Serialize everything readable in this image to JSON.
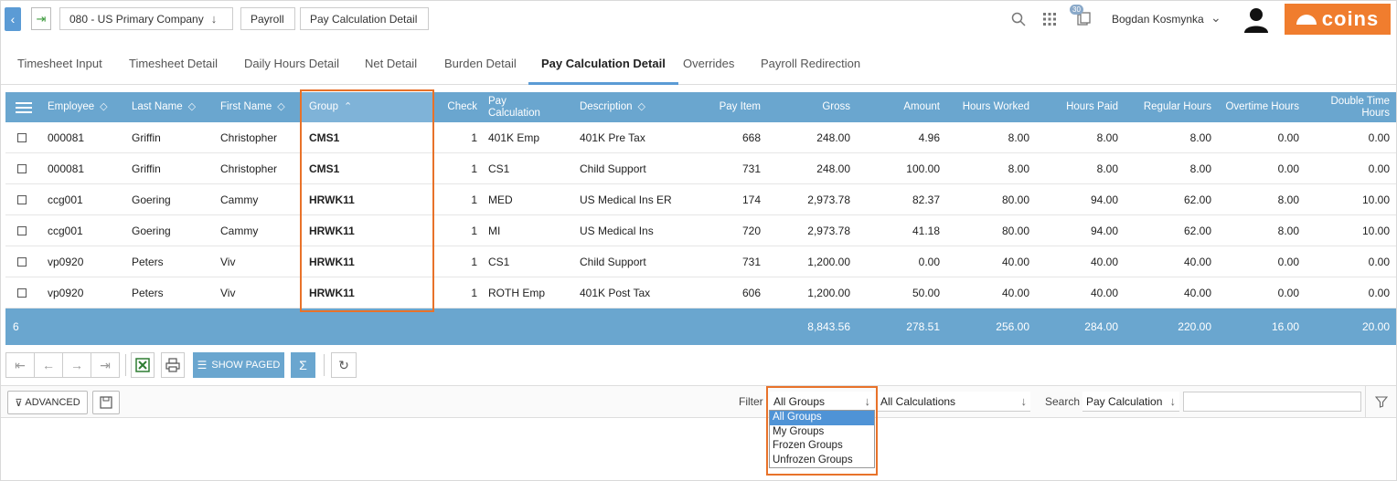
{
  "breadcrumb": {
    "company": "080 - US Primary Company",
    "module": "Payroll",
    "page": "Pay Calculation Detail"
  },
  "header": {
    "notification_count": "30",
    "username": "Bogdan Kosmynka",
    "logo_text": "coins",
    "accent_color": "#f07d2e"
  },
  "tabs": [
    {
      "label": "Timesheet Input"
    },
    {
      "label": "Timesheet Detail"
    },
    {
      "label": "Daily Hours Detail"
    },
    {
      "label": "Net Detail"
    },
    {
      "label": "Burden Detail"
    },
    {
      "label": "Pay Calculation Detail",
      "active": true
    },
    {
      "label": "Overrides"
    },
    {
      "label": "Payroll Redirection"
    }
  ],
  "grid": {
    "header_color": "#6aa6cf",
    "columns": {
      "employee": "Employee",
      "last_name": "Last Name",
      "first_name": "First Name",
      "group": "Group",
      "check": "Check",
      "pay_calc_1": "Pay",
      "pay_calc_2": "Calculation",
      "description": "Description",
      "pay_item": "Pay Item",
      "gross": "Gross",
      "amount": "Amount",
      "hours_worked": "Hours Worked",
      "hours_paid": "Hours Paid",
      "regular_hours": "Regular Hours",
      "overtime_hours": "Overtime Hours",
      "double_time_1": "Double Time",
      "double_time_2": "Hours"
    },
    "rows": [
      {
        "employee": "000081",
        "last_name": "Griffin",
        "first_name": "Christopher",
        "group": "CMS1",
        "check": "1",
        "pay_calc": "401K Emp",
        "description": "401K Pre Tax",
        "pay_item": "668",
        "gross": "248.00",
        "amount": "4.96",
        "hours_worked": "8.00",
        "hours_paid": "8.00",
        "regular_hours": "8.00",
        "overtime_hours": "0.00",
        "double_time": "0.00"
      },
      {
        "employee": "000081",
        "last_name": "Griffin",
        "first_name": "Christopher",
        "group": "CMS1",
        "check": "1",
        "pay_calc": "CS1",
        "description": "Child Support",
        "pay_item": "731",
        "gross": "248.00",
        "amount": "100.00",
        "hours_worked": "8.00",
        "hours_paid": "8.00",
        "regular_hours": "8.00",
        "overtime_hours": "0.00",
        "double_time": "0.00"
      },
      {
        "employee": "ccg001",
        "last_name": "Goering",
        "first_name": "Cammy",
        "group": "HRWK11",
        "check": "1",
        "pay_calc": "MED",
        "description": "US Medical Ins ER",
        "pay_item": "174",
        "gross": "2,973.78",
        "amount": "82.37",
        "hours_worked": "80.00",
        "hours_paid": "94.00",
        "regular_hours": "62.00",
        "overtime_hours": "8.00",
        "double_time": "10.00"
      },
      {
        "employee": "ccg001",
        "last_name": "Goering",
        "first_name": "Cammy",
        "group": "HRWK11",
        "check": "1",
        "pay_calc": "MI",
        "description": "US Medical Ins",
        "pay_item": "720",
        "gross": "2,973.78",
        "amount": "41.18",
        "hours_worked": "80.00",
        "hours_paid": "94.00",
        "regular_hours": "62.00",
        "overtime_hours": "8.00",
        "double_time": "10.00"
      },
      {
        "employee": "vp0920",
        "last_name": "Peters",
        "first_name": "Viv",
        "group": "HRWK11",
        "check": "1",
        "pay_calc": "CS1",
        "description": "Child Support",
        "pay_item": "731",
        "gross": "1,200.00",
        "amount": "0.00",
        "hours_worked": "40.00",
        "hours_paid": "40.00",
        "regular_hours": "40.00",
        "overtime_hours": "0.00",
        "double_time": "0.00"
      },
      {
        "employee": "vp0920",
        "last_name": "Peters",
        "first_name": "Viv",
        "group": "HRWK11",
        "check": "1",
        "pay_calc": "ROTH Emp",
        "description": "401K Post Tax",
        "pay_item": "606",
        "gross": "1,200.00",
        "amount": "50.00",
        "hours_worked": "40.00",
        "hours_paid": "40.00",
        "regular_hours": "40.00",
        "overtime_hours": "0.00",
        "double_time": "0.00"
      }
    ],
    "totals": {
      "count": "6",
      "gross": "8,843.56",
      "amount": "278.51",
      "hours_worked": "256.00",
      "hours_paid": "284.00",
      "regular_hours": "220.00",
      "overtime_hours": "16.00",
      "double_time": "20.00"
    }
  },
  "toolbar": {
    "show_paged_label": "SHOW PAGED",
    "sum_symbol": "Σ"
  },
  "filter": {
    "advanced_label": "ADVANCED",
    "filter_label": "Filter",
    "group_value": "All Groups",
    "calc_value": "All Calculations",
    "search_label": "Search",
    "search_field_value": "Pay Calculation",
    "search_input_value": "",
    "group_options": [
      "All Groups",
      "My Groups",
      "Frozen Groups",
      "Unfrozen Groups"
    ],
    "highlight_color": "#e8722a"
  }
}
